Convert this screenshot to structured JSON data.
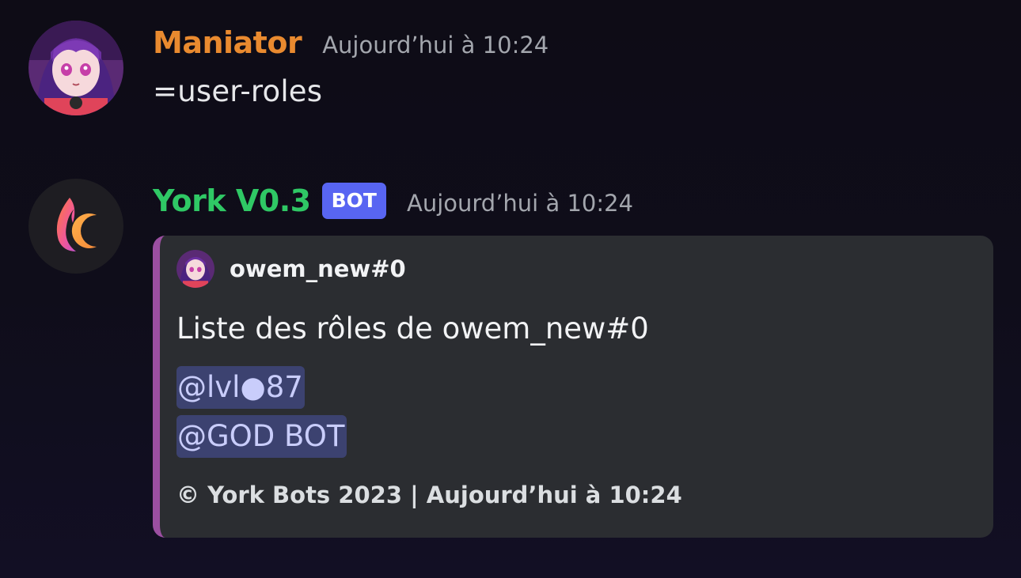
{
  "messages": [
    {
      "author": "Maniator",
      "author_color": "#e98a2f",
      "timestamp": "Aujourd’hui à 10:24",
      "avatar_icon": "anime-avatar",
      "text": "=user-roles"
    },
    {
      "author": "York V0.3",
      "author_color": "#2fc865",
      "bot_tag": "BOT",
      "bot_tag_color": "#5865f2",
      "timestamp": "Aujourd’hui à 10:24",
      "avatar_icon": "flame-moon-logo",
      "embed": {
        "accent_color": "#9b4fa1",
        "author_name": "owem_new#0",
        "author_icon": "anime-avatar",
        "title": "Liste des rôles de owem_new#0",
        "roles": [
          "@lvl●87",
          "@GOD BOT"
        ],
        "footer": "© York Bots 2023 | Aujourd’hui à 10:24"
      }
    }
  ]
}
